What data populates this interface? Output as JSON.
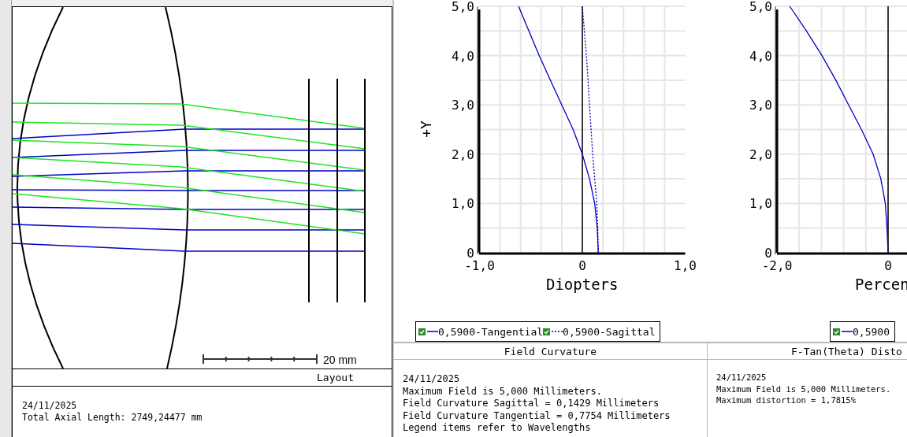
{
  "layout_panel": {
    "scale_bar_label": "20 mm",
    "title": "Layout",
    "notes": [
      "24/11/2025",
      "Total Axial Length: 2749,24477 mm"
    ]
  },
  "field_curvature": {
    "chart_data": {
      "type": "line",
      "orientation": "horizontal",
      "xlabel": "Diopters",
      "ylabel": "+Y",
      "x": [
        0,
        0.5,
        1,
        1.5,
        2,
        2.5,
        3,
        3.5,
        4,
        4.5,
        5
      ],
      "series": [
        {
          "name": "0,5900-Tangential",
          "color": "#0000c0",
          "line_style": "solid",
          "values": [
            0.155,
            0.145,
            0.12,
            0.07,
            0.0,
            -0.09,
            -0.2,
            -0.31,
            -0.42,
            -0.52,
            -0.62
          ]
        },
        {
          "name": "0,5900-Sagittal",
          "color": "#0000c0",
          "line_style": "dotted",
          "values": [
            0.155,
            0.15,
            0.14,
            0.12,
            0.1,
            0.085,
            0.07,
            0.055,
            0.04,
            0.02,
            0.0
          ]
        }
      ],
      "xlim": [
        -1,
        1
      ],
      "ylim": [
        0,
        5
      ],
      "grid": true,
      "xticks": [
        {
          "value": -1,
          "label": "-1,0"
        },
        {
          "value": 0,
          "label": "0"
        },
        {
          "value": 1,
          "label": "1,0"
        }
      ],
      "yticks": [
        {
          "value": 0,
          "label": "0"
        },
        {
          "value": 1,
          "label": "1,0"
        },
        {
          "value": 2,
          "label": "2,0"
        },
        {
          "value": 3,
          "label": "3,0"
        },
        {
          "value": 4,
          "label": "4,0"
        },
        {
          "value": 5,
          "label": "5,0"
        }
      ]
    },
    "legend": [
      {
        "checked": true
      },
      {
        "checked": true
      }
    ],
    "title": "Field Curvature",
    "notes": [
      "24/11/2025",
      "Maximum Field is 5,000 Millimeters.",
      "Field Curvature Sagittal = 0,1429 Millimeters",
      "Field Curvature Tangential = 0,7754 Millimeters",
      "Legend items refer to Wavelengths"
    ]
  },
  "distortion": {
    "chart_data": {
      "type": "line",
      "orientation": "horizontal",
      "xlabel": "Percen",
      "x": [
        0,
        0.5,
        1,
        1.5,
        2,
        2.5,
        3,
        3.5,
        4,
        4.5,
        5
      ],
      "series": [
        {
          "name": "0,5900",
          "color": "#0000c0",
          "line_style": "solid",
          "values": [
            0,
            -0.02,
            -0.05,
            -0.13,
            -0.27,
            -0.48,
            -0.71,
            -0.94,
            -1.19,
            -1.47,
            -1.77
          ]
        }
      ],
      "xlim": [
        -2,
        2
      ],
      "ylim": [
        0,
        5
      ],
      "grid": true,
      "xticks": [
        {
          "value": -2,
          "label": "-2,0"
        },
        {
          "value": 0,
          "label": "0"
        }
      ],
      "yticks": [
        {
          "value": 0,
          "label": "0"
        },
        {
          "value": 1,
          "label": "1,0"
        },
        {
          "value": 2,
          "label": "2,0"
        },
        {
          "value": 3,
          "label": "3,0"
        },
        {
          "value": 4,
          "label": "4,0"
        },
        {
          "value": 5,
          "label": "5,0"
        }
      ]
    },
    "legend": [
      {
        "checked": true
      }
    ],
    "title": "F-Tan(Theta) Disto",
    "notes": [
      "24/11/2025",
      "Maximum Field is 5,000 Millimeters.",
      "Maximum distortion = 1,7815%"
    ]
  }
}
